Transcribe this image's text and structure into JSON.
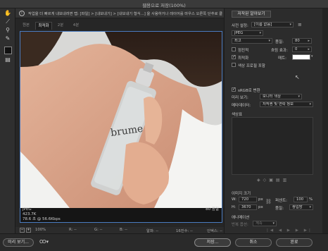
{
  "window": {
    "title": "웹용으로 저장(100%)"
  },
  "infobar": {
    "text": "작업을 더 빠르게 내보내려면 탭: [파일] > [내보내기] > [내보내기 형식...] 을 사용하거나 레이어를 마우스 오른쪽 단추로 클릭하면 됩니다."
  },
  "tabs": [
    {
      "label": "원본"
    },
    {
      "label": "최적화"
    },
    {
      "label": "2분"
    },
    {
      "label": "4분"
    }
  ],
  "preview": {
    "format": "JPEG",
    "size": "423.7K",
    "time": "78.6 초 @ 56.6Kbps",
    "quality_label": "80 품질",
    "product_text": "brume"
  },
  "status": {
    "zoom": "100%",
    "r": "R: --",
    "g": "G: --",
    "b": "B: --",
    "alpha": "알파: --",
    "hex": "16진수: --",
    "index": "인덱스: --"
  },
  "panel": {
    "header": "저작된 알아보기",
    "preset_label": "사전 설정:",
    "preset_value": "[이름 없음]",
    "format_value": "JPEG",
    "quality_preset": "최고",
    "quality_label": "품질:",
    "quality_value": "80",
    "progressive_label": "점진적",
    "blur_label": "흐림 효과:",
    "blur_value": "0",
    "optimized_label": "최적화",
    "matte_label": "매트:",
    "embed_label": "색상 프로필 포함",
    "srgb_label": "sRGB로 변환",
    "preview_label": "미리 보기:",
    "preview_value": "모니터 색상",
    "metadata_label": "메타데이터:",
    "metadata_value": "저작권 및 연락 정보",
    "color_table_label": "색상표",
    "image_size_label": "이미지 크기",
    "w_label": "W:",
    "w_value": "720",
    "h_label": "H:",
    "h_value": "3670",
    "px": "px",
    "percent_label": "퍼센트:",
    "percent_value": "100",
    "percent_unit": "%",
    "quality2_label": "품질:",
    "quality2_value": "쌍입방",
    "animation_label": "애니메이션",
    "loop_label": "반복 옵션:",
    "loop_value": "계속"
  },
  "bottom": {
    "preview_button": "미리 보기...",
    "save_button": "저장...",
    "cancel_button": "취소",
    "done_button": "완료"
  },
  "colors": {
    "accent": "#4a7bc0",
    "bg": "#262626"
  }
}
